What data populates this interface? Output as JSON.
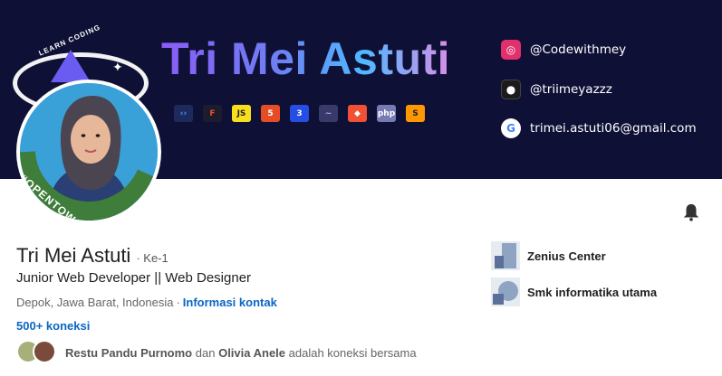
{
  "banner": {
    "name": "Tri Mei Astuti",
    "logo_text": "LEARN CODING",
    "tech_icons": [
      {
        "icon": "vscode-icon",
        "glyph": "‹›",
        "bg": "#1e2a5e",
        "fg": "#3ea6ff"
      },
      {
        "icon": "figma-icon",
        "glyph": "F",
        "bg": "#1c1c2e",
        "fg": "#f24e1e"
      },
      {
        "icon": "javascript-icon",
        "glyph": "JS",
        "bg": "#f7df1e",
        "fg": "#222222"
      },
      {
        "icon": "html5-icon",
        "glyph": "5",
        "bg": "#e44d26",
        "fg": "#ffffff"
      },
      {
        "icon": "css3-icon",
        "glyph": "3",
        "bg": "#264de4",
        "fg": "#ffffff"
      },
      {
        "icon": "jquery-icon",
        "glyph": "~",
        "bg": "#3a3a6a",
        "fg": "#9fb4ff"
      },
      {
        "icon": "git-icon",
        "glyph": "◆",
        "bg": "#f05033",
        "fg": "#ffffff"
      },
      {
        "icon": "php-icon",
        "glyph": "php",
        "bg": "#777bb4",
        "fg": "#ffffff"
      },
      {
        "icon": "sublime-icon",
        "glyph": "S",
        "bg": "#ff9800",
        "fg": "#222222"
      }
    ],
    "social": [
      {
        "icon": "instagram-icon",
        "glyph": "◎",
        "bg": "#e1306c",
        "fg": "#ffffff",
        "text": "@Codewithmey"
      },
      {
        "icon": "github-icon",
        "glyph": "●",
        "bg": "#1b1b1b",
        "fg": "#ffffff",
        "text": "@triimeyazzz"
      },
      {
        "icon": "google-icon",
        "glyph": "G",
        "bg": "#ffffff",
        "fg": "#4285f4",
        "text": "trimei.astuti06@gmail.com"
      }
    ]
  },
  "profile": {
    "open_to_work": "#OPENTOWORK",
    "name": "Tri Mei Astuti",
    "degree": "· Ke-1",
    "headline": "Junior Web Developer || Web Designer",
    "location": "Depok, Jawa Barat, Indonesia",
    "location_sep": "·",
    "contact_info": "Informasi kontak",
    "connections": "500+ koneksi",
    "mutual": {
      "person1": "Restu Pandu Purnomo",
      "joiner": "dan",
      "person2": "Olivia Anele",
      "suffix": "adalah koneksi bersama"
    }
  },
  "sidebar": {
    "orgs": [
      {
        "name": "Zenius Center"
      },
      {
        "name": "Smk informatika utama"
      }
    ]
  },
  "colors": {
    "link": "#0a66c2",
    "banner_bg": "#0f1036",
    "open_to_work_green": "#3f7d3a"
  }
}
